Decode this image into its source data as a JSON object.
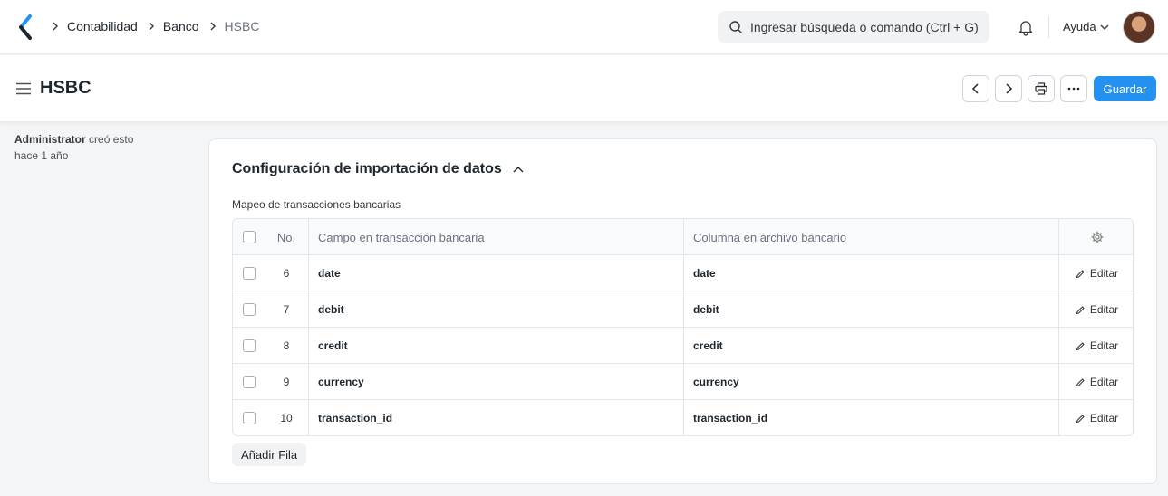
{
  "navbar": {
    "breadcrumbs": [
      "Contabilidad",
      "Banco",
      "HSBC"
    ],
    "search_placeholder": "Ingresar búsqueda o comando (Ctrl + G)",
    "help_label": "Ayuda"
  },
  "page": {
    "title": "HSBC",
    "save_label": "Guardar"
  },
  "meta": {
    "author": "Administrator",
    "action": "creó esto",
    "time": "hace 1 año"
  },
  "section": {
    "title": "Configuración de importación de datos",
    "field_label": "Mapeo de transacciones bancarias",
    "columns": {
      "no": "No.",
      "field": "Campo en transacción bancaria",
      "column": "Columna en archivo bancario"
    },
    "rows": [
      {
        "no": "6",
        "field": "date",
        "column": "date",
        "action": "Editar"
      },
      {
        "no": "7",
        "field": "debit",
        "column": "debit",
        "action": "Editar"
      },
      {
        "no": "8",
        "field": "credit",
        "column": "credit",
        "action": "Editar"
      },
      {
        "no": "9",
        "field": "currency",
        "column": "currency",
        "action": "Editar"
      },
      {
        "no": "10",
        "field": "transaction_id",
        "column": "transaction_id",
        "action": "Editar"
      }
    ],
    "add_row_label": "Añadir Fila"
  },
  "colors": {
    "primary": "#2490ef",
    "logo": "#2490ef"
  },
  "icons": [
    "logo-icon",
    "search-icon",
    "bell-icon",
    "chevron-down-icon",
    "hamburger-icon",
    "chevron-left-icon",
    "chevron-right-icon",
    "printer-icon",
    "more-icon",
    "chevron-up-icon",
    "gear-icon",
    "pencil-icon"
  ]
}
